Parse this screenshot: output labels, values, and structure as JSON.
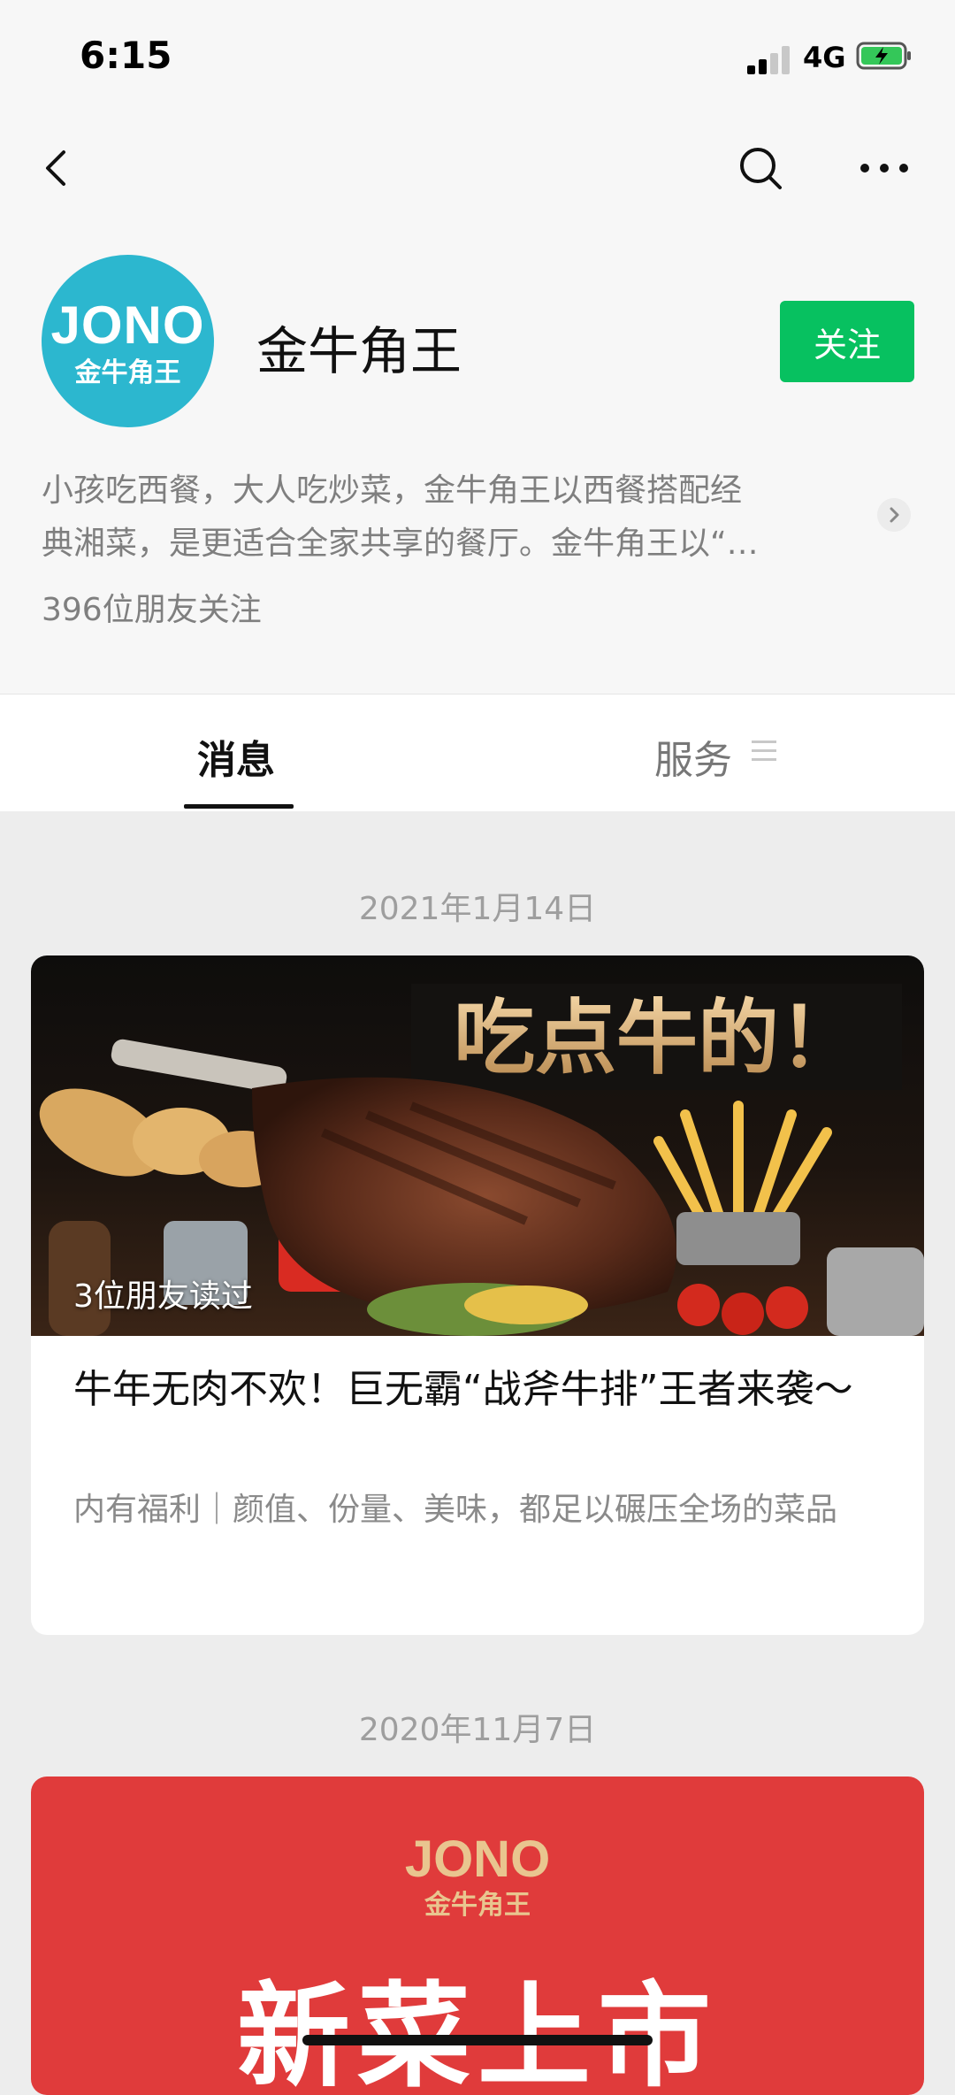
{
  "status_bar": {
    "time": "6:15",
    "network": "4G"
  },
  "profile": {
    "logo_top": "JONO",
    "logo_bottom": "金牛角王",
    "name": "金牛角王",
    "follow_label": "关注",
    "description_line1": "小孩吃西餐，大人吃炒菜，金牛角王以西餐搭配经",
    "description_line2": "典湘菜，是更适合全家共享的餐厅。金牛角王以“…",
    "followers": "396位朋友关注"
  },
  "tabs": {
    "messages": "消息",
    "services": "服务"
  },
  "feed": {
    "date1": "2021年1月14日",
    "article1": {
      "cover_text": "吃点牛的！",
      "read_count": "3位朋友读过",
      "title": "牛年无肉不欢！巨无霸“战斧牛排”王者来袭～",
      "digest": "内有福利｜颜值、份量、美味，都足以碾压全场的菜品"
    },
    "date2": "2020年11月7日",
    "article2": {
      "logo_top": "JONO",
      "logo_bottom": "金牛角王",
      "headline": "新菜上市"
    }
  },
  "colors": {
    "accent_green": "#07c160",
    "avatar_bg": "#2cb7cf",
    "promo_red": "#e03b3b"
  }
}
